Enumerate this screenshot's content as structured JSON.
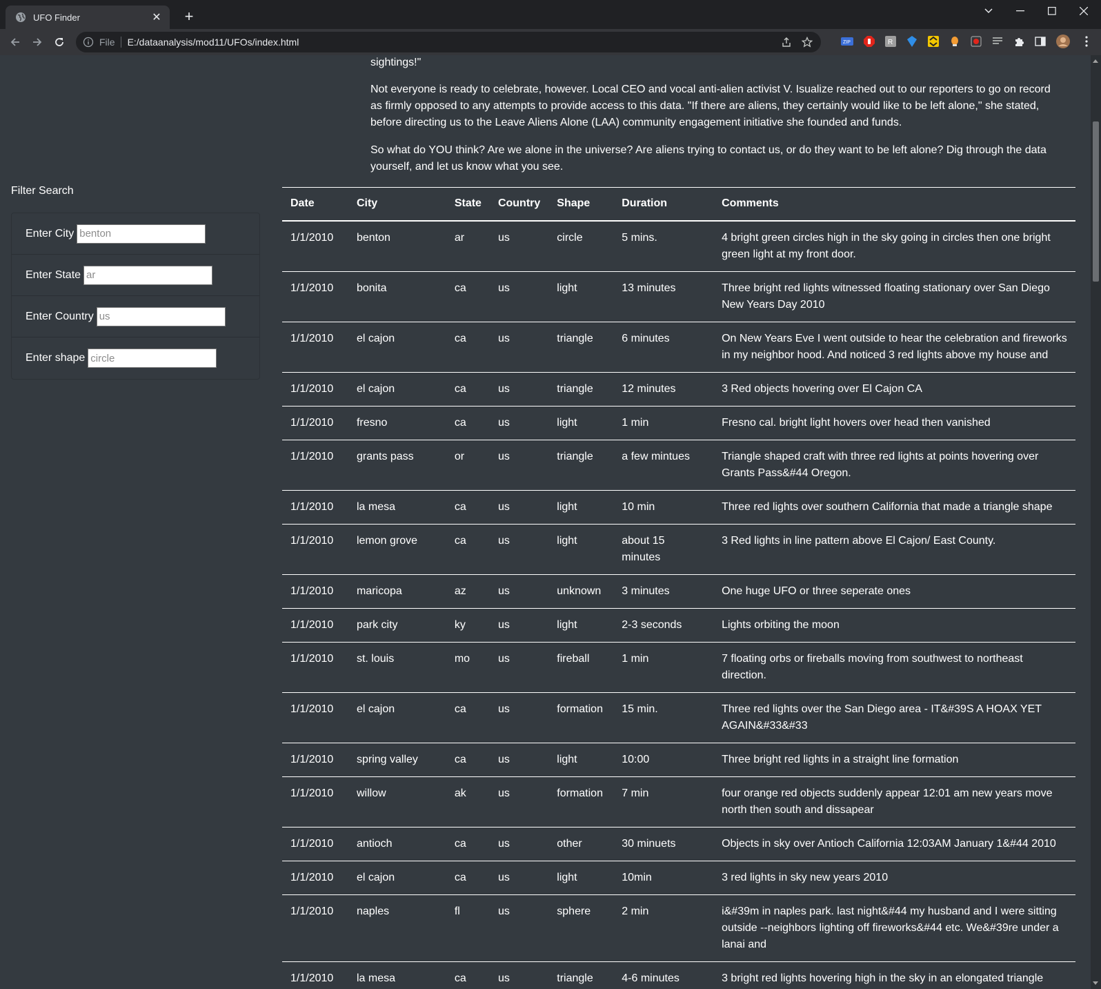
{
  "browser": {
    "tab_title": "UFO Finder",
    "new_tab_symbol": "+",
    "close_symbol": "✕",
    "scheme_label": "File",
    "url": "E:/dataanalysis/mod11/UFOs/index.html"
  },
  "article": {
    "paragraph_tail": "sightings!\"",
    "paragraph_activist": "Not everyone is ready to celebrate, however. Local CEO and vocal anti-alien activist V. Isualize reached out to our reporters to go on record as firmly opposed to any attempts to provide access to this data. \"If there are aliens, they certainly would like to be left alone,\" she stated, before directing us to the Leave Aliens Alone (LAA) community engagement initiative she founded and funds.",
    "paragraph_question": "So what do YOU think? Are we alone in the universe? Are aliens trying to contact us, or do they want to be left alone? Dig through the data yourself, and let us know what you see."
  },
  "filters": {
    "heading": "Filter Search",
    "city": {
      "label": "Enter City",
      "placeholder": "benton"
    },
    "state": {
      "label": "Enter State",
      "placeholder": "ar"
    },
    "country": {
      "label": "Enter Country",
      "placeholder": "us"
    },
    "shape": {
      "label": "Enter shape",
      "placeholder": "circle"
    }
  },
  "table": {
    "headers": [
      "Date",
      "City",
      "State",
      "Country",
      "Shape",
      "Duration",
      "Comments"
    ],
    "rows": [
      [
        "1/1/2010",
        "benton",
        "ar",
        "us",
        "circle",
        "5 mins.",
        "4 bright green circles high in the sky going in circles then one bright green light at my front door."
      ],
      [
        "1/1/2010",
        "bonita",
        "ca",
        "us",
        "light",
        "13 minutes",
        "Three bright red lights witnessed floating stationary over San Diego New Years Day 2010"
      ],
      [
        "1/1/2010",
        "el cajon",
        "ca",
        "us",
        "triangle",
        "6 minutes",
        "On New Years Eve I went outside to hear the celebration and fireworks in my neighbor hood. And noticed 3 red lights above my house and"
      ],
      [
        "1/1/2010",
        "el cajon",
        "ca",
        "us",
        "triangle",
        "12 minutes",
        "3 Red objects hovering over El Cajon CA"
      ],
      [
        "1/1/2010",
        "fresno",
        "ca",
        "us",
        "light",
        "1 min",
        "Fresno cal. bright light hovers over head then vanished"
      ],
      [
        "1/1/2010",
        "grants pass",
        "or",
        "us",
        "triangle",
        "a few mintues",
        "Triangle shaped craft with three red lights at points hovering over Grants Pass&#44 Oregon."
      ],
      [
        "1/1/2010",
        "la mesa",
        "ca",
        "us",
        "light",
        "10 min",
        "Three red lights over southern California that made a triangle shape"
      ],
      [
        "1/1/2010",
        "lemon grove",
        "ca",
        "us",
        "light",
        "about 15 minutes",
        "3 Red lights in line pattern above El Cajon/ East County."
      ],
      [
        "1/1/2010",
        "maricopa",
        "az",
        "us",
        "unknown",
        "3 minutes",
        "One huge UFO or three seperate ones"
      ],
      [
        "1/1/2010",
        "park city",
        "ky",
        "us",
        "light",
        "2-3 seconds",
        "Lights orbiting the moon"
      ],
      [
        "1/1/2010",
        "st. louis",
        "mo",
        "us",
        "fireball",
        "1 min",
        "7 floating orbs or fireballs moving from southwest to northeast direction."
      ],
      [
        "1/1/2010",
        "el cajon",
        "ca",
        "us",
        "formation",
        "15 min.",
        "Three red lights over the San Diego area - IT&#39S A HOAX YET AGAIN&#33&#33"
      ],
      [
        "1/1/2010",
        "spring valley",
        "ca",
        "us",
        "light",
        "10:00",
        "Three bright red lights in a straight line formation"
      ],
      [
        "1/1/2010",
        "willow",
        "ak",
        "us",
        "formation",
        "7 min",
        "four orange red objects suddenly appear 12:01 am new years move north then south and dissapear"
      ],
      [
        "1/1/2010",
        "antioch",
        "ca",
        "us",
        "other",
        "30 minuets",
        "Objects in sky over Antioch California 12:03AM January 1&#44 2010"
      ],
      [
        "1/1/2010",
        "el cajon",
        "ca",
        "us",
        "light",
        "10min",
        "3 red lights in sky new years 2010"
      ],
      [
        "1/1/2010",
        "naples",
        "fl",
        "us",
        "sphere",
        "2 min",
        "i&#39m in naples park. last night&#44 my husband and I were sitting outside --neighbors lighting off fireworks&#44 etc. We&#39re under a lanai and"
      ],
      [
        "1/1/2010",
        "la mesa",
        "ca",
        "us",
        "triangle",
        "4-6 minutes",
        "3 bright red lights hovering high in the sky in an elongated triangle"
      ]
    ]
  }
}
